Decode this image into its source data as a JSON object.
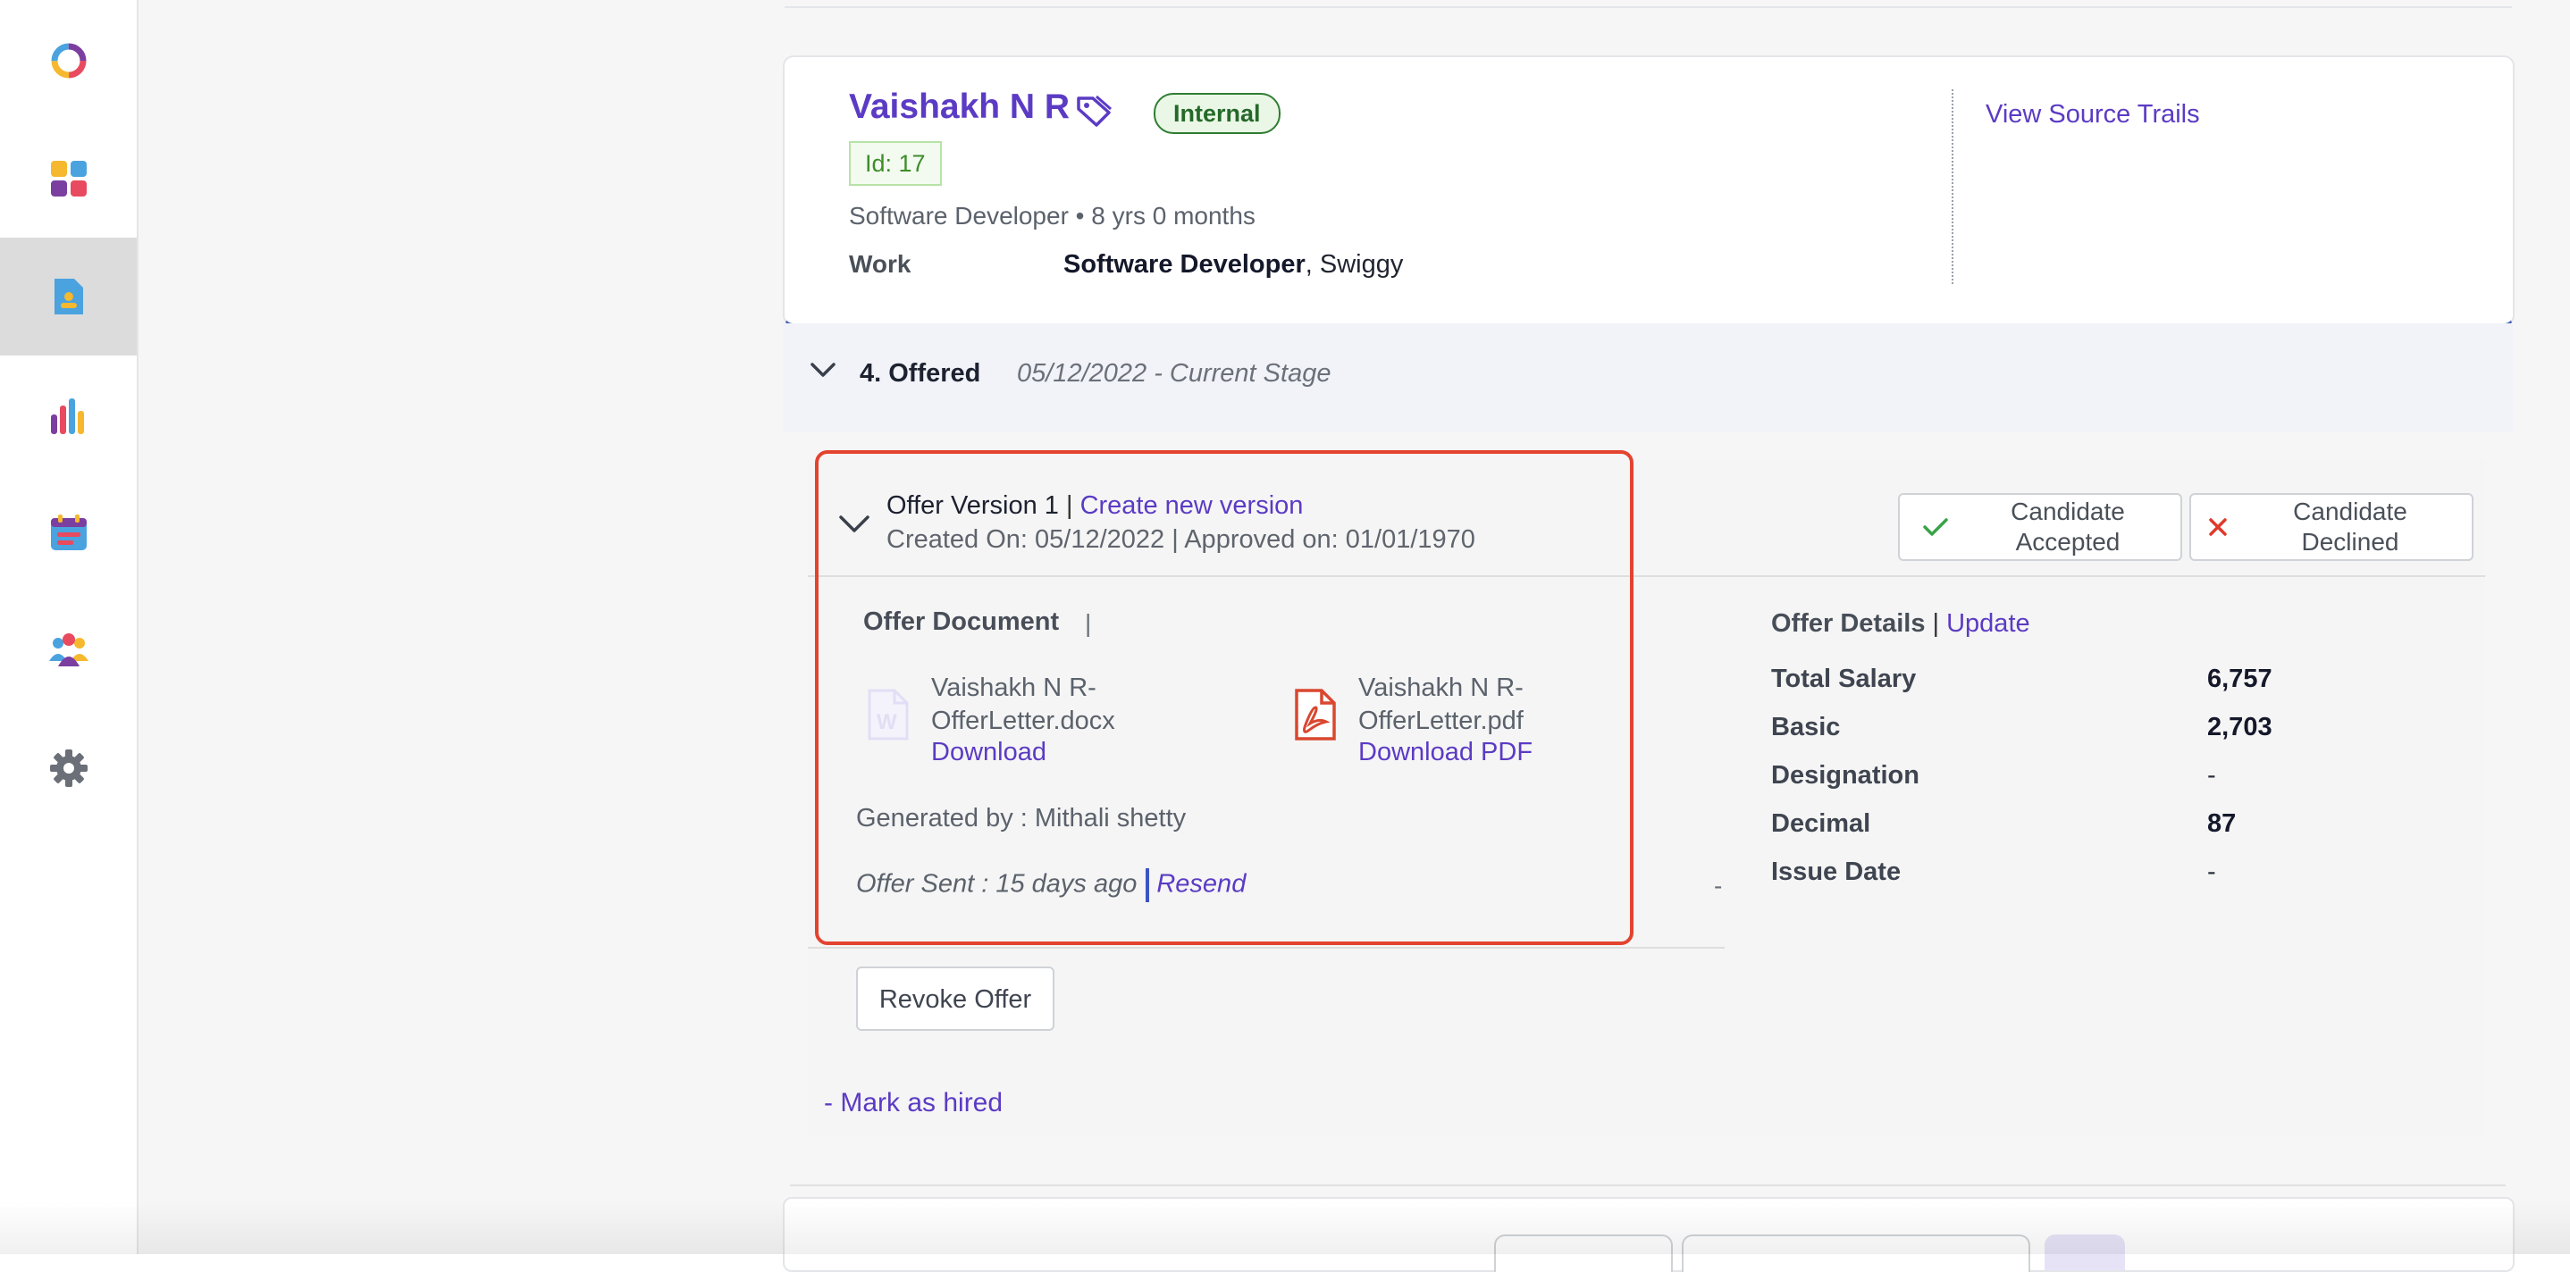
{
  "sidebar": {
    "items": [
      {
        "icon": "logo-ring-icon",
        "label": ""
      },
      {
        "icon": "dashboard-grid-icon",
        "label": ""
      },
      {
        "icon": "candidate-document-icon",
        "label": "",
        "active": true
      },
      {
        "icon": "reports-bar-chart-icon",
        "label": ""
      },
      {
        "icon": "calendar-icon",
        "label": ""
      },
      {
        "icon": "team-icon",
        "label": ""
      },
      {
        "icon": "settings-gear-icon",
        "label": ""
      }
    ]
  },
  "candidate": {
    "name": "Vaishakh N R",
    "badge": "Internal",
    "id_label": "Id: 17",
    "subtitle": "Software Developer • 8 yrs 0 months",
    "work_label": "Work",
    "work_role": "Software Developer",
    "work_company": ", Swiggy",
    "source_link": "View Source Trails"
  },
  "stage": {
    "title": "4. Offered",
    "date": "05/12/2022 - Current Stage"
  },
  "offer": {
    "version_title": "Offer Version 1",
    "separator": " | ",
    "create_new": "Create new version",
    "dates": "Created On: 05/12/2022 | Approved on: 01/01/1970",
    "accepted_label": "Candidate Accepted",
    "declined_label": "Candidate Declined",
    "document_heading": "Offer Document",
    "document_bar": "|",
    "files": [
      {
        "name": "Vaishakh N R-OfferLetter.docx",
        "link": "Download",
        "icon": "word-document-icon"
      },
      {
        "name": "Vaishakh N R-OfferLetter.pdf",
        "link": "Download PDF",
        "icon": "pdf-document-icon"
      }
    ],
    "generated_by": "Generated by :  Mithali shetty",
    "offer_sent": "Offer Sent : 15 days ago",
    "resend": "Resend",
    "mid_dash": "-",
    "revoke": "Revoke Offer",
    "mark_hired": "- Mark as hired",
    "details_heading": "Offer Details",
    "details_separator": " | ",
    "details_update": "Update",
    "details": [
      {
        "key": "Total Salary",
        "value": "6,757"
      },
      {
        "key": "Basic",
        "value": "2,703"
      },
      {
        "key": "Designation",
        "value": "-"
      },
      {
        "key": "Decimal",
        "value": "87"
      },
      {
        "key": "Issue Date",
        "value": "-"
      }
    ]
  },
  "colors": {
    "accent": "#5b3bc4",
    "highlight": "#e3432f",
    "internal_green": "#2f7d32"
  }
}
